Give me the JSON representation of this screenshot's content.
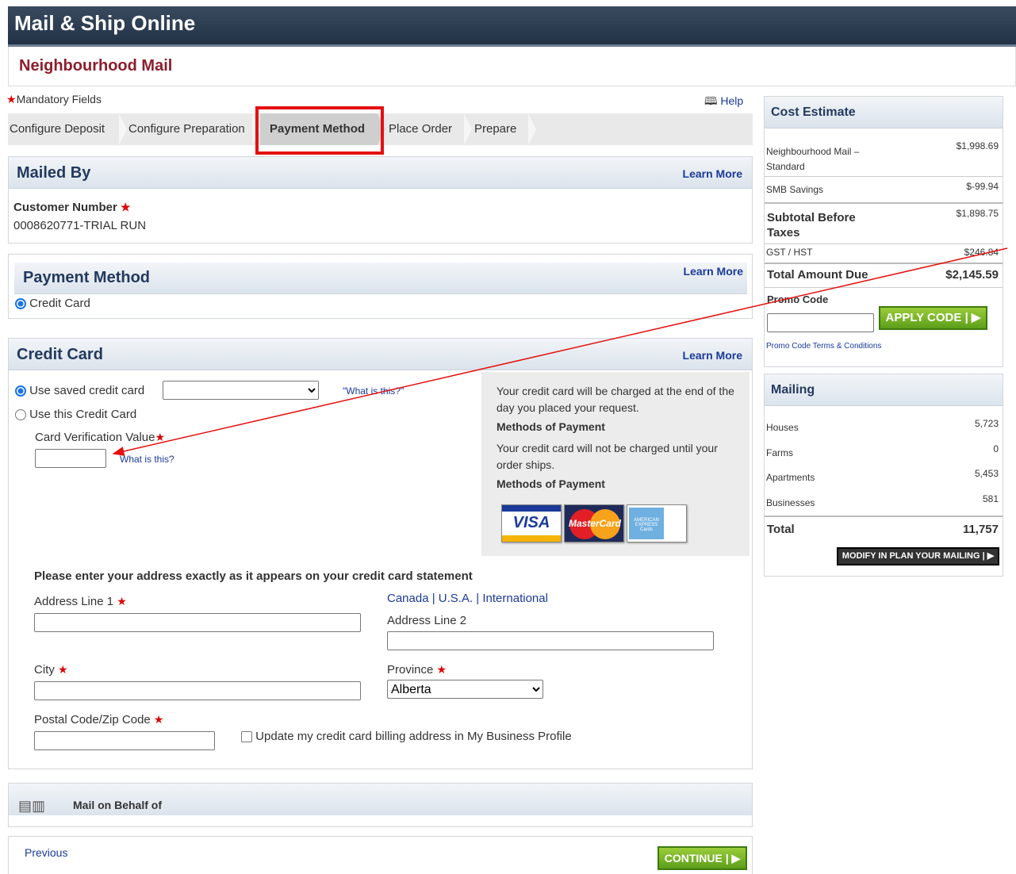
{
  "app": {
    "title": "Mail & Ship Online",
    "service": "Neighbourhood Mail"
  },
  "mandatory_label": "Mandatory Fields",
  "help_label": "Help",
  "steps": [
    "Configure Deposit",
    "Configure Preparation",
    "Payment Method",
    "Place Order",
    "Prepare"
  ],
  "active_step": "Payment Method",
  "mailed_by": {
    "title": "Mailed By",
    "learn_more": "Learn More",
    "customer_label": "Customer Number",
    "customer_value": "0008620771-TRIAL RUN"
  },
  "payment_method": {
    "title": "Payment Method",
    "learn_more": "Learn More",
    "option": "Credit Card"
  },
  "credit_card": {
    "title": "Credit Card",
    "learn_more": "Learn More",
    "use_saved": "Use saved credit card",
    "saved_value": "",
    "what_is_this_quoted": "\"What is this?\"",
    "use_this": "Use this Credit Card",
    "cvv_label": "Card Verification Value",
    "cvv_what": "What is this?",
    "info_1": "Your credit card will be charged at the end of the day you placed your request.",
    "methods_1": "Methods of Payment",
    "info_2": "Your credit card will not be charged until your order ships.",
    "methods_2": "Methods of Payment",
    "cards": [
      "VISA",
      "MasterCard",
      "AMERICAN EXPRESS Cards"
    ],
    "address_heading": "Please enter your address exactly as it appears on your credit card statement",
    "address1_label": "Address Line 1",
    "country_links": [
      "Canada",
      "U.S.A.",
      "International"
    ],
    "address2_label": "Address Line 2",
    "city_label": "City",
    "province_label": "Province",
    "province_value": "Alberta",
    "postal_label": "Postal Code/Zip Code",
    "update_label": "Update my credit card billing address in My Business Profile"
  },
  "mail_on_behalf": {
    "label": "Mail on Behalf of"
  },
  "nav": {
    "previous": "Previous",
    "continue": "CONTINUE"
  },
  "cost_estimate": {
    "title": "Cost Estimate",
    "rows": [
      {
        "label": "Neighbourhood Mail – Standard",
        "value": "$1,998.69"
      },
      {
        "label": "SMB Savings",
        "value": "$-99.94"
      }
    ],
    "subtotal_label": "Subtotal Before Taxes",
    "subtotal_value": "$1,898.75",
    "tax_label": "GST / HST",
    "tax_value": "$246.84",
    "total_label": "Total Amount Due",
    "total_value": "$2,145.59",
    "promo_label": "Promo Code",
    "promo_value": "",
    "apply_label": "APPLY CODE",
    "terms_label": "Promo Code Terms & Conditions"
  },
  "mailing": {
    "title": "Mailing",
    "rows": [
      {
        "label": "Houses",
        "value": "5,723"
      },
      {
        "label": "Farms",
        "value": "0"
      },
      {
        "label": "Apartments",
        "value": "5,453"
      },
      {
        "label": "Businesses",
        "value": "581"
      }
    ],
    "total_label": "Total",
    "total_value": "11,757",
    "modify_label": "MODIFY IN PLAN YOUR MAILING"
  },
  "colors": {
    "brand_header": "#2a3a50",
    "service_title": "#8b1e2d",
    "annotation_red": "#e41111",
    "button_green": "#6fb124"
  }
}
